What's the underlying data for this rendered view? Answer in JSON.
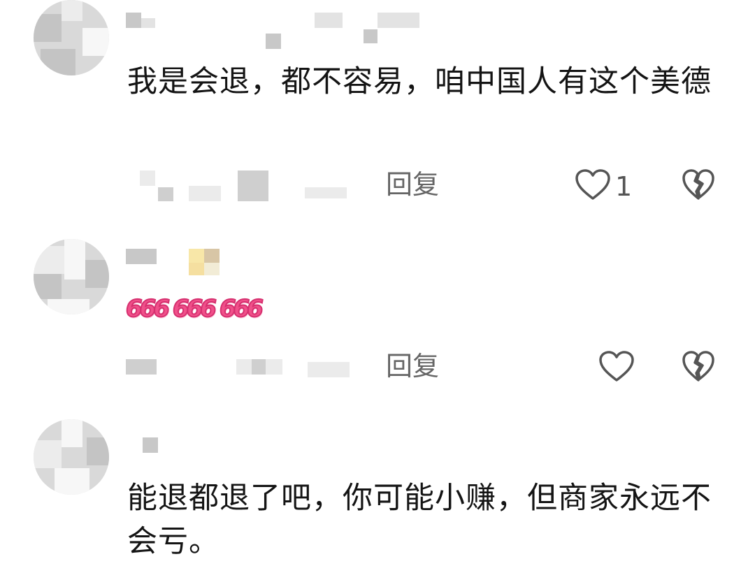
{
  "comments": [
    {
      "text": "我是会退，都不容易，咱中国人有这个美德",
      "reply_label": "回复",
      "like_count": "1",
      "like_icon": "heart-outline-icon",
      "dislike_icon": "broken-heart-icon"
    },
    {
      "stickers": [
        "666",
        "666",
        "666"
      ],
      "reply_label": "回复",
      "like_count": "",
      "like_icon": "heart-outline-icon",
      "dislike_icon": "broken-heart-icon"
    },
    {
      "text": "能退都退了吧，你可能小赚，但商家永远不会亏。"
    }
  ],
  "colors": {
    "text": "#141414",
    "secondary": "#666666",
    "sticker": "#f0508a"
  }
}
